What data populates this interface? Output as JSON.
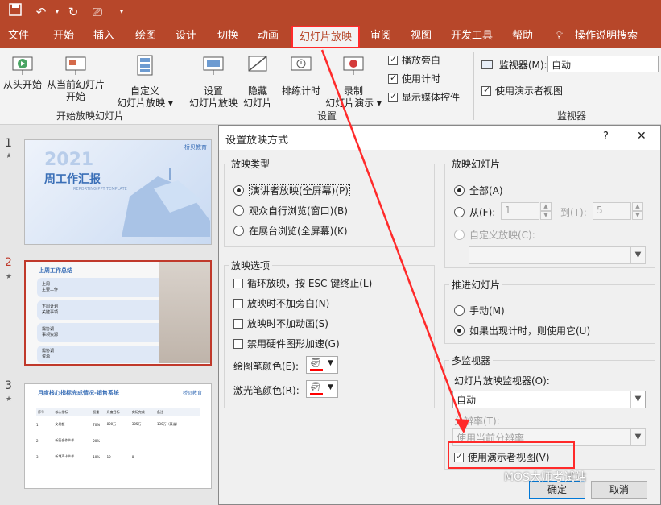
{
  "ribbon_tabs": [
    "文件",
    "开始",
    "插入",
    "绘图",
    "设计",
    "切换",
    "动画",
    "幻灯片放映",
    "审阅",
    "视图",
    "开发工具",
    "帮助",
    "操作说明搜索"
  ],
  "ribbon": {
    "from_start": "从头开始",
    "from_current": [
      "从当前幻灯片",
      "开始"
    ],
    "custom_show": [
      "自定义",
      "幻灯片放映 ▾"
    ],
    "group_start": "开始放映幻灯片",
    "setup_show": [
      "设置",
      "幻灯片放映"
    ],
    "hide_slide": [
      "隐藏",
      "幻灯片"
    ],
    "rehearse": "排练计时",
    "record": [
      "录制",
      "幻灯片演示 ▾"
    ],
    "chk_narration": "播放旁白",
    "chk_timings": "使用计时",
    "chk_media": "显示媒体控件",
    "group_setup": "设置",
    "monitor_label": "监视器(M):",
    "monitor_value": "自动",
    "presenter_view": "使用演示者视图",
    "group_monitors": "监视器"
  },
  "slides": [
    {
      "num": "1",
      "star": "★",
      "year": "2021",
      "title": "周工作汇报",
      "sub": "REPORTING PPT TEMPLATE",
      "brand": "桥贝教育"
    },
    {
      "num": "2",
      "star": "★",
      "title": "上周工作总结",
      "items": [
        "上周\n主要工作",
        "下周计划\n关键事项",
        "需协调\n事项资源",
        "需协调\n资源"
      ]
    },
    {
      "num": "3",
      "star": "★",
      "title": "月度核心指标完成情况-销售系统",
      "brand": "桥贝教育",
      "cols": [
        "序号",
        "核心指标",
        "权重",
        "月度目标",
        "实际完成",
        "备注"
      ],
      "rows": [
        [
          "1",
          "交易额",
          "70%",
          "800万",
          "305万",
          "130万（某省）"
        ],
        [
          "2",
          "新签合作伙伴",
          "20%",
          "",
          "",
          ""
        ],
        [
          "3",
          "新增声卡伙伴",
          "10%",
          "10",
          "8",
          ""
        ]
      ]
    }
  ],
  "dialog": {
    "title": "设置放映方式",
    "help": "?",
    "close": "✕",
    "show_type": {
      "label": "放映类型",
      "options": [
        "演讲者放映(全屏幕)(P)",
        "观众自行浏览(窗口)(B)",
        "在展台浏览(全屏幕)(K)"
      ],
      "selected": 0
    },
    "show_options": {
      "label": "放映选项",
      "items": [
        "循环放映，按 ESC 键终止(L)",
        "放映时不加旁白(N)",
        "放映时不加动画(S)",
        "禁用硬件图形加速(G)"
      ],
      "pen_color": "绘图笔颜色(E):",
      "laser_color": "激光笔颜色(R):"
    },
    "show_slides": {
      "label": "放映幻灯片",
      "all": "全部(A)",
      "from": "从(F):",
      "from_value": "1",
      "to": "到(T):",
      "to_value": "5",
      "custom": "自定义放映(C):"
    },
    "advance": {
      "label": "推进幻灯片",
      "manual": "手动(M)",
      "timings": "如果出现计时，则使用它(U)"
    },
    "monitors": {
      "label": "多监视器",
      "monitor_label": "幻灯片放映监视器(O):",
      "monitor_value": "自动",
      "resolution_label": "分辨率(T):",
      "resolution_value": "使用当前分辨率",
      "presenter_view": "使用演示者视图(V)"
    },
    "ok": "确定",
    "cancel": "取消"
  },
  "watermark": "MOS大师考试站",
  "colors": {
    "accent": "#b7472a",
    "highlight": "#ff2a2a",
    "pen": "#ff0000"
  }
}
